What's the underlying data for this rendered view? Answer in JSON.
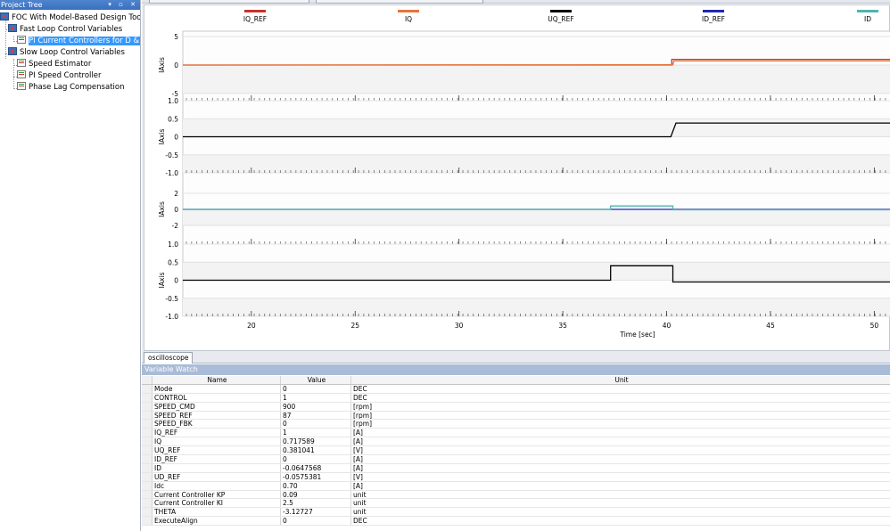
{
  "project_tree": {
    "title": "Project Tree",
    "header_buttons": "▾ ▫ ✕",
    "items": [
      {
        "label": "FOC With Model-Based Design Toolbox",
        "level": 0
      },
      {
        "label": "Fast Loop Control Variables",
        "level": 1
      },
      {
        "label": "PI Current Controllers for D & Q",
        "level": 2,
        "selected": true
      },
      {
        "label": "Slow Loop Control Variables",
        "level": 1
      },
      {
        "label": "Speed Estimator",
        "level": 2
      },
      {
        "label": "PI Speed Controller",
        "level": 2
      },
      {
        "label": "Phase Lag Compensation",
        "level": 2
      }
    ]
  },
  "scope": {
    "legend": [
      {
        "label": "IQ_REF",
        "color": "#c83232"
      },
      {
        "label": "IQ",
        "color": "#e8743b"
      },
      {
        "label": "UQ_REF",
        "color": "#000000"
      },
      {
        "label": "ID_REF",
        "color": "#1e28b4"
      },
      {
        "label": "ID",
        "color": "#4fb4b0"
      }
    ],
    "x_label": "Time [sec]",
    "x_ticks": [
      "20",
      "25",
      "30",
      "35",
      "40",
      "45",
      "50"
    ],
    "tab_label": "oscilloscope"
  },
  "chart_data": {
    "type": "line",
    "x_range": [
      16.7,
      50.8
    ],
    "xlabel": "Time [sec]",
    "panels": [
      {
        "ylabel": "IAxis",
        "ylim": [
          -5,
          5
        ],
        "y_ticks": [
          "5",
          "0",
          "-5"
        ],
        "series": [
          {
            "name": "IQ_REF",
            "color": "#c83232",
            "x": [
              16.7,
              40.25,
              40.25,
              50.8
            ],
            "y": [
              0,
              0,
              1,
              1
            ]
          },
          {
            "name": "IQ",
            "color": "#e8743b",
            "x": [
              16.7,
              37.3,
              40.3,
              40.35,
              50.8
            ],
            "y": [
              0,
              0.05,
              0.05,
              0.72,
              0.72
            ]
          }
        ]
      },
      {
        "ylabel": "IAxis",
        "ylim": [
          -1.0,
          1.0
        ],
        "y_ticks": [
          "1.0",
          "0.5",
          "0",
          "-0.5",
          "-1.0"
        ],
        "series": [
          {
            "name": "UQ_REF",
            "color": "#000000",
            "x": [
              16.7,
              40.2,
              40.45,
              50.8
            ],
            "y": [
              0,
              0,
              0.381,
              0.381
            ]
          }
        ]
      },
      {
        "ylabel": "IAxis",
        "ylim": [
          -3,
          3
        ],
        "y_ticks": [
          "2",
          "0",
          "-2"
        ],
        "series": [
          {
            "name": "ID_REF",
            "color": "#1e28b4",
            "x": [
              16.7,
              40.3,
              40.3,
              50.8
            ],
            "y": [
              0,
              0,
              0,
              0
            ]
          },
          {
            "name": "ID",
            "color": "#4fb4b0",
            "x": [
              16.7,
              37.3,
              37.3,
              40.3,
              40.3,
              50.8
            ],
            "y": [
              0,
              0,
              0.42,
              0.42,
              -0.06,
              -0.06
            ]
          }
        ]
      },
      {
        "ylabel": "IAxis",
        "ylim": [
          -1.0,
          1.0
        ],
        "y_ticks": [
          "1.0",
          "0.5",
          "0",
          "-0.5",
          "-1.0"
        ],
        "series": [
          {
            "name": "UD_REF",
            "color": "#000000",
            "x": [
              16.7,
              37.3,
              37.3,
              40.3,
              40.3,
              50.8
            ],
            "y": [
              0,
              0,
              0.4,
              0.4,
              -0.05,
              -0.05
            ]
          }
        ]
      }
    ]
  },
  "watch": {
    "title": "Variable Watch",
    "columns": [
      "Name",
      "Value",
      "Unit"
    ],
    "rows": [
      [
        "Mode",
        "0",
        "DEC"
      ],
      [
        "CONTROL",
        "1",
        "DEC"
      ],
      [
        "SPEED_CMD",
        "900",
        "[rpm]"
      ],
      [
        "SPEED_REF",
        "87",
        "[rpm]"
      ],
      [
        "SPEED_FBK",
        "0",
        "[rpm]"
      ],
      [
        "IQ_REF",
        "1",
        "[A]"
      ],
      [
        "IQ",
        "0.717589",
        "[A]"
      ],
      [
        "UQ_REF",
        "0.381041",
        "[V]"
      ],
      [
        "ID_REF",
        "0",
        "[A]"
      ],
      [
        "ID",
        "-0.0647568",
        "[A]"
      ],
      [
        "UD_REF",
        "-0.0575381",
        "[V]"
      ],
      [
        "Idc",
        "0.70",
        "[A]"
      ],
      [
        "Current Controller KP",
        "0.09",
        "unit"
      ],
      [
        "Current Controller KI",
        "2.5",
        "unit"
      ],
      [
        "THETA",
        "-3.12727",
        "unit"
      ],
      [
        "ExecuteAlign",
        "0",
        "DEC"
      ]
    ]
  }
}
